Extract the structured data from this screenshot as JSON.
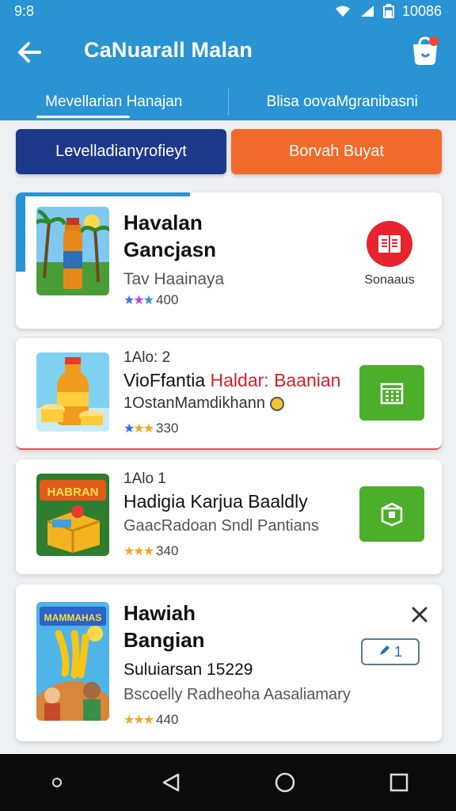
{
  "status_bar": {
    "time": "9:8",
    "clock_right": "10086"
  },
  "app_bar": {
    "title": "CaNuarall Malan",
    "back_icon": "back-arrow-icon",
    "cart_icon": "shopping-bag-icon"
  },
  "tabs": [
    {
      "label": "Mevellarian Hanajan",
      "active": true
    },
    {
      "label": "Blisa oovaMgranibasni",
      "active": false
    }
  ],
  "actions": {
    "primary_label": "Levelladianyrofieyt",
    "secondary_label": "Borvah Buyat"
  },
  "cards": [
    {
      "title_line1": "Havalan",
      "title_line2": "Gancjasn",
      "subtitle": "Tav Haainaya",
      "rating": "400",
      "side_label": "Sonaaus",
      "side_icon": "book-icon"
    },
    {
      "eyebrow": "1Alo: 2",
      "title_black": "VioFfantia ",
      "title_red": "Haldar: Baanian",
      "subtitle": "1OstanMamdikhann",
      "rating": "330",
      "action_icon": "building-icon"
    },
    {
      "eyebrow": "1Alo 1",
      "title": "Hadigia Karjua Baaldly",
      "subtitle": "GaacRadoan Sndl Pantians",
      "rating": "340",
      "action_icon": "box-icon",
      "thumb_label": "HABRAN"
    },
    {
      "title_line1": "Hawiah",
      "title_line2": "Bangian",
      "eyebrow": "Suluiarsan 15229",
      "subtitle": "Bscoelly Radheoha Aasaliamary",
      "rating": "440",
      "badge": "1",
      "thumb_label": "MAMMAHAS"
    }
  ],
  "colors": {
    "primary_blue": "#2a93d3",
    "navy": "#1d3a8a",
    "orange": "#f26a2b",
    "green": "#4caf2a",
    "red": "#d11f2a"
  }
}
